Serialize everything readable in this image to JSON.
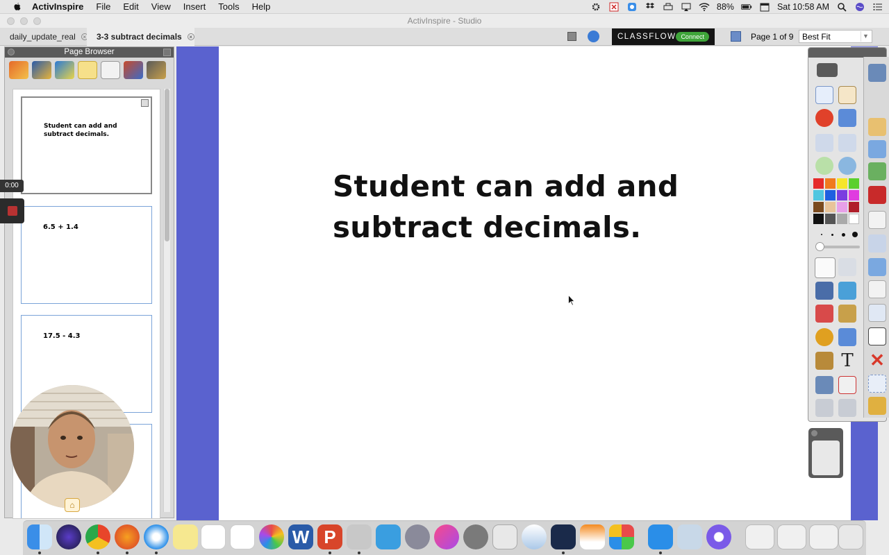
{
  "menubar": {
    "app_name": "ActivInspire",
    "menus": [
      "File",
      "Edit",
      "View",
      "Insert",
      "Tools",
      "Help"
    ],
    "battery": "88%",
    "clock": "Sat 10:58 AM"
  },
  "window": {
    "title": "ActivInspire - Studio"
  },
  "tabs": [
    {
      "label": "daily_update_real",
      "active": false
    },
    {
      "label": "3-3 subtract decimals",
      "active": true
    }
  ],
  "toolbar": {
    "classflow_label": "CLASSFLOW",
    "connect_label": "Connect",
    "page_indicator": "Page 1 of 9",
    "zoom_value": "Best Fit"
  },
  "page_browser": {
    "title": "Page Browser",
    "pages": [
      {
        "text": "Student can add and subtract decimals.",
        "selected": true
      },
      {
        "text": "6.5 + 1.4",
        "selected": false
      },
      {
        "text": "17.5 - 4.3",
        "selected": false
      },
      {
        "text": "",
        "selected": false
      }
    ]
  },
  "recording": {
    "timer": "0:00"
  },
  "slide": {
    "title": "Student can add and subtract decimals."
  },
  "colors": {
    "stage_bg": "#5a62cf",
    "classflow_green": "#3fa53a",
    "palette": [
      "#e52a2a",
      "#f07a1e",
      "#f6e62a",
      "#5bd02c",
      "#4fc6e0",
      "#1e5fe0",
      "#7a3de0",
      "#e03ce0",
      "#7a4a1e",
      "#e8c49a",
      "#e8a0e8",
      "#b01e2a",
      "#111111",
      "#555555",
      "#aaaaaa",
      "#ffffff"
    ]
  }
}
